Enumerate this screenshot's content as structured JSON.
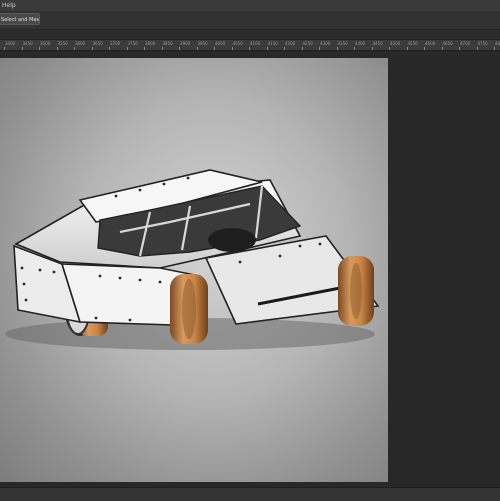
{
  "menubar": {
    "help_label": "Help"
  },
  "options_bar": {
    "select_mask_label": "Select and Mask..."
  },
  "ruler": {
    "labels": [
      "3400",
      "3450",
      "3500",
      "3550",
      "3600",
      "3650",
      "3700",
      "3750",
      "3800",
      "3850",
      "3900",
      "3950",
      "4000",
      "4050",
      "4100",
      "4150",
      "4200",
      "4250",
      "4300",
      "4350",
      "4400",
      "4450",
      "4500",
      "4550",
      "4600",
      "4650",
      "4700",
      "4750",
      "4800"
    ]
  },
  "colors": {
    "canvas_light": "#d4d4d4",
    "canvas_dark": "#7d7d7d",
    "tire": "#c8854a",
    "body": "#f2f2f2"
  },
  "canvas_image": {
    "subject": "dirt modified race car"
  }
}
